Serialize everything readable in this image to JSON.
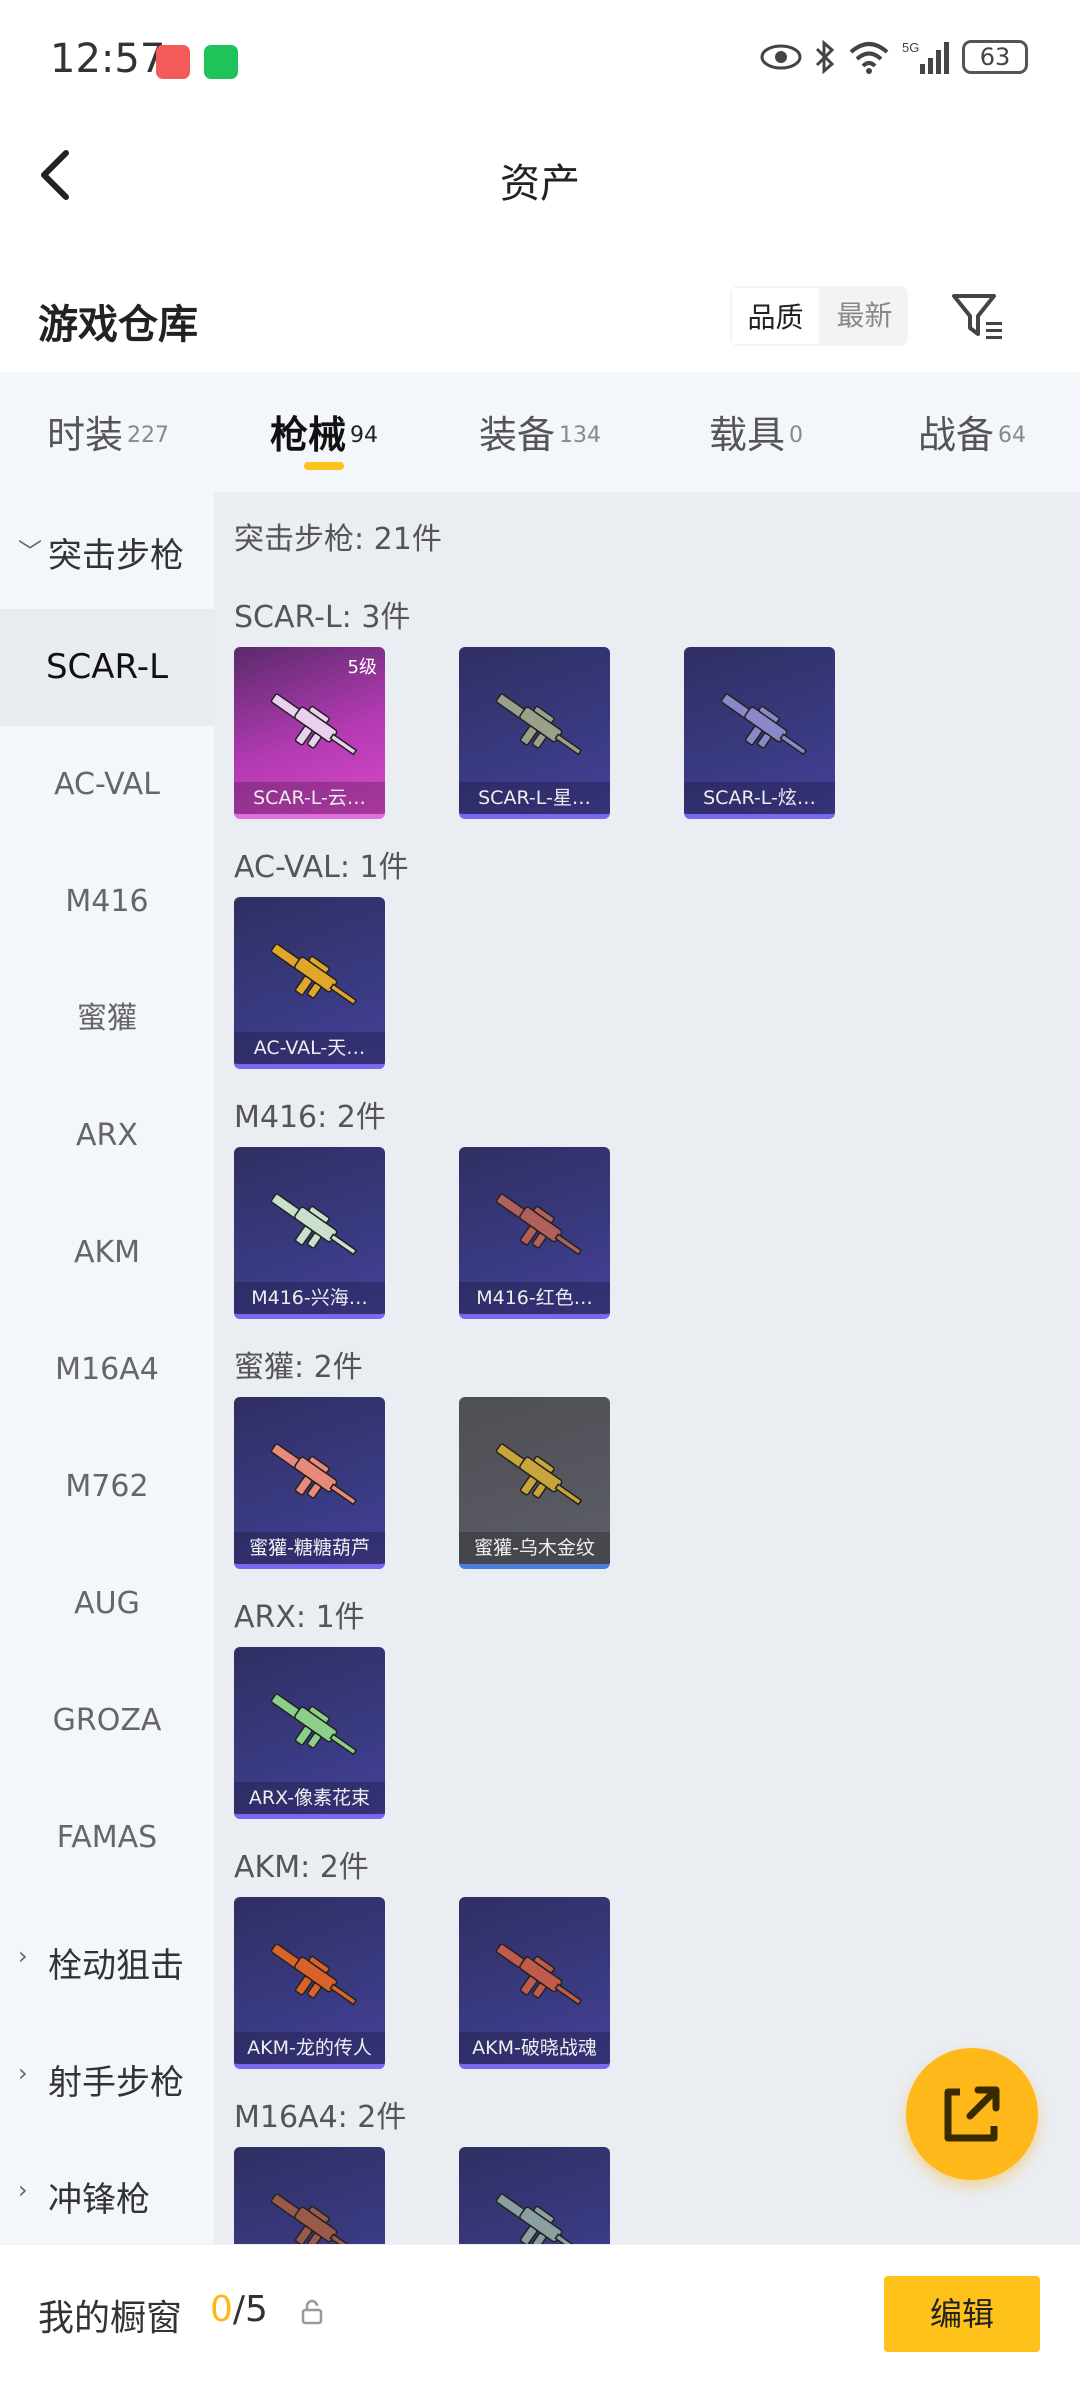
{
  "status": {
    "time": "12:57",
    "battery": "63",
    "network": "5G"
  },
  "header": {
    "title": "资产"
  },
  "warehouse": {
    "title": "游戏仓库",
    "sort_options": [
      "品质",
      "最新"
    ]
  },
  "tabs": [
    {
      "label": "时装",
      "count": "227"
    },
    {
      "label": "枪械",
      "count": "94"
    },
    {
      "label": "装备",
      "count": "134"
    },
    {
      "label": "载具",
      "count": "0"
    },
    {
      "label": "战备",
      "count": "64"
    }
  ],
  "sidebar": {
    "category_open": "突击步枪",
    "items": [
      "SCAR-L",
      "AC-VAL",
      "M416",
      "蜜獾",
      "ARX",
      "AKM",
      "M16A4",
      "M762",
      "AUG",
      "GROZA",
      "FAMAS"
    ],
    "categories_closed": [
      "栓动狙击",
      "射手步枪",
      "冲锋枪"
    ]
  },
  "content": {
    "section_title": "突击步枪: 21件",
    "groups": [
      {
        "title": "SCAR-L: 3件",
        "cards": [
          {
            "name": "SCAR-L-云…",
            "level": "5级",
            "gun_color": "#e8d0ee"
          },
          {
            "name": "SCAR-L-星…",
            "gun_color": "#9aa08a"
          },
          {
            "name": "SCAR-L-炫…",
            "gun_color": "#8a88c8"
          }
        ]
      },
      {
        "title": "AC-VAL: 1件",
        "cards": [
          {
            "name": "AC-VAL-天…",
            "gun_color": "#e0a72a"
          }
        ]
      },
      {
        "title": "M416: 2件",
        "cards": [
          {
            "name": "M416-兴海…",
            "gun_color": "#c8e0cc"
          },
          {
            "name": "M416-红色…",
            "gun_color": "#b0605a"
          }
        ]
      },
      {
        "title": "蜜獾: 2件",
        "cards": [
          {
            "name": "蜜獾-糖糖葫芦",
            "gun_color": "#e88a7a"
          },
          {
            "name": "蜜獾-乌木金纹",
            "gun_color": "#c9a43a"
          }
        ]
      },
      {
        "title": "ARX: 1件",
        "cards": [
          {
            "name": "ARX-像素花束",
            "gun_color": "#8ccf8a"
          }
        ]
      },
      {
        "title": "AKM: 2件",
        "cards": [
          {
            "name": "AKM-龙的传人",
            "gun_color": "#d8622a"
          },
          {
            "name": "AKM-破晓战魂",
            "gun_color": "#c05a4a"
          }
        ]
      },
      {
        "title": "M16A4: 2件",
        "cards": [
          {
            "name": "",
            "gun_color": "#9a5a4a"
          },
          {
            "name": "",
            "gun_color": "#8aa0a0"
          }
        ]
      }
    ]
  },
  "bottom": {
    "showcase_label": "我的橱窗",
    "showcase_current": "0",
    "showcase_total": "/5",
    "edit_label": "编辑"
  },
  "colors": {
    "accent": "#ffc21a",
    "fab": "#ffb81a"
  }
}
